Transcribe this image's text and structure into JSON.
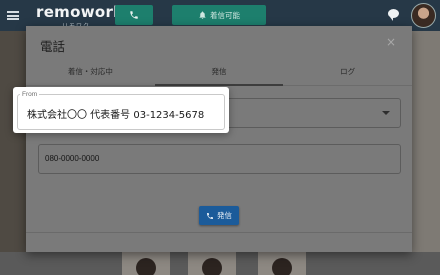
{
  "app": {
    "logo": "remowork",
    "logo_sub": "リモワク",
    "status_label": "着信可能",
    "icons": [
      "menu-icon",
      "phone-icon",
      "bell-icon",
      "chat-icon",
      "avatar"
    ]
  },
  "dialog": {
    "title": "電話",
    "close": "×",
    "tabs": [
      {
        "label": "着信・対応中",
        "active": false
      },
      {
        "label": "発信",
        "active": true
      },
      {
        "label": "ログ",
        "active": false
      }
    ],
    "number_value": "080-0000-0000",
    "call_button": "発信"
  },
  "caller_select": {
    "legend": "From",
    "value": "株式会社〇〇 代表番号 03-1234-5678"
  },
  "colors": {
    "appbar": "#263847",
    "accent_green": "#1d7f6d",
    "call_blue": "#1b5b9a"
  }
}
